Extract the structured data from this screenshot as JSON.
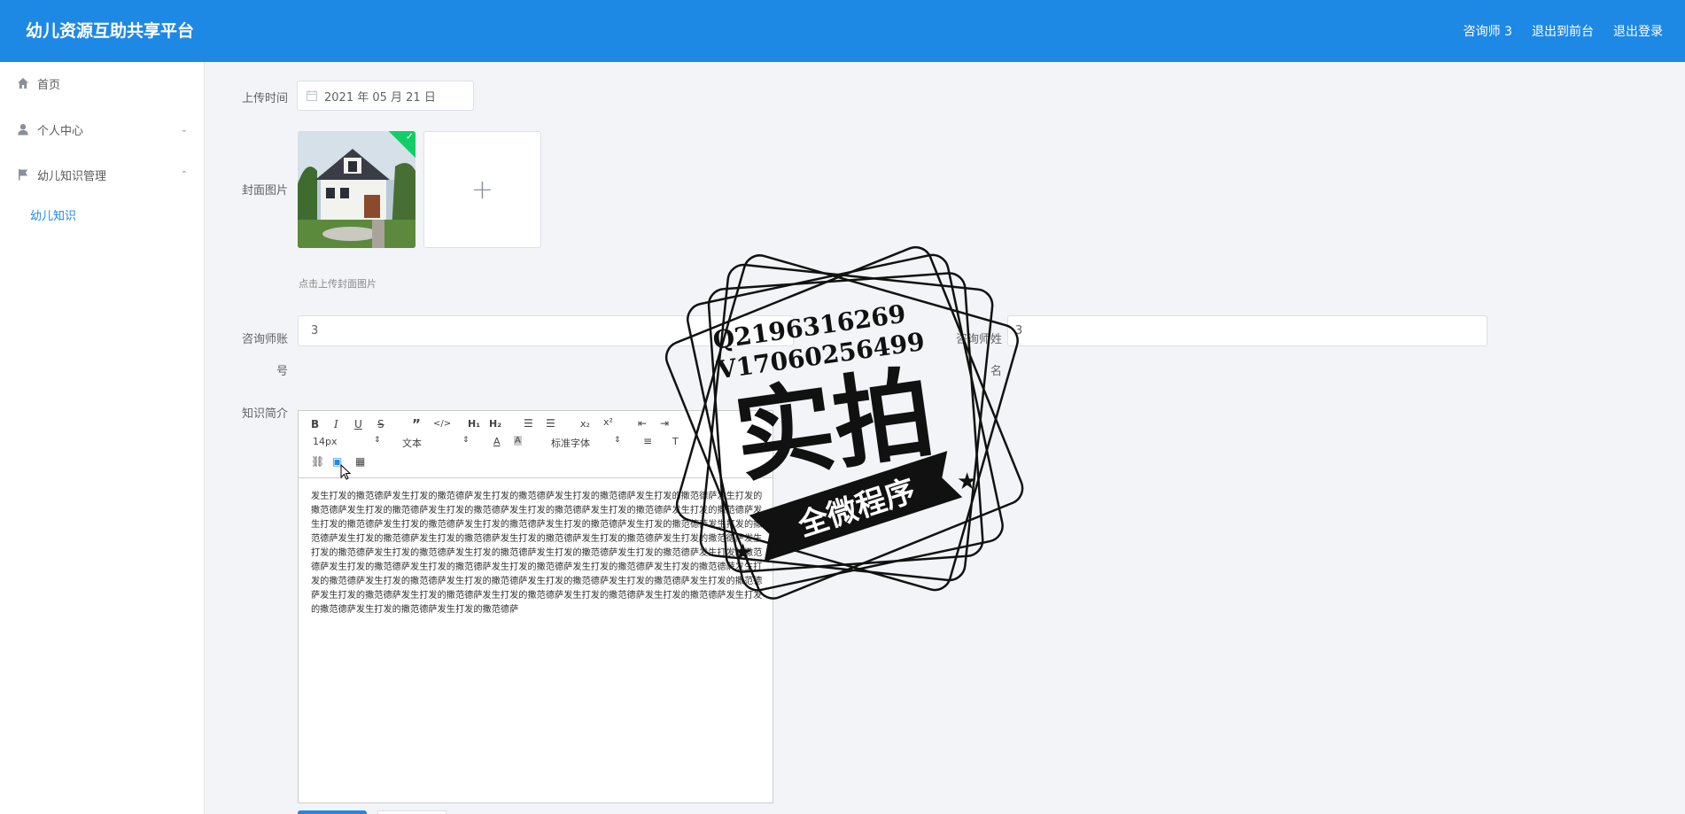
{
  "header": {
    "brand": "幼儿资源互助共享平台",
    "user": "咨询师 3",
    "back_front": "退出到前台",
    "logout": "退出登录",
    "color": "#1e88e5"
  },
  "sidebar": {
    "items": [
      {
        "label": "首页",
        "icon": "home-icon"
      },
      {
        "label": "个人中心",
        "icon": "user-icon",
        "chevron": "⌄"
      },
      {
        "label": "幼儿知识管理",
        "icon": "flag-icon",
        "chevron": "⌃"
      }
    ],
    "sub_item": "幼儿知识"
  },
  "form": {
    "upload_time_label": "上传时间",
    "upload_time_value": "2021 年 05 月 21 日",
    "cover_label": "封面图片",
    "upload_plus": "+",
    "upload_hint": "点击上传封面图片",
    "account_label_1": "咨询师账",
    "account_label_2": "号",
    "account_value": "3",
    "name_label_1": "咨询师姓",
    "name_label_2": "名",
    "name_value": "3",
    "intro_label": "知识简介"
  },
  "editor": {
    "font_size": "14px",
    "paragraph": "文本",
    "font_family": "标准字体",
    "content": "发生打发的撒范德萨发生打发的撒范德萨发生打发的撒范德萨发生打发的撒范德萨发生打发的撒范德萨发生打发的撒范德萨发生打发的撒范德萨发生打发的撒范德萨发生打发的撒范德萨发生打发的撒范德萨发生打发的撒范德萨发生打发的撒范德萨发生打发的撒范德萨发生打发的撒范德萨发生打发的撒范德萨发生打发的撒范德萨发生打发的撒范德萨发生打发的撒范德萨发生打发的撒范德萨发生打发的撒范德萨发生打发的撒范德萨发生打发的撒范德萨发生打发的撒范德萨发生打发的撒范德萨发生打发的撒范德萨发生打发的撒范德萨发生打发的撒范德萨发生打发的撒范德萨发生打发的撒范德萨发生打发的撒范德萨发生打发的撒范德萨发生打发的撒范德萨发生打发的撒范德萨发生打发的撒范德萨发生打发的撒范德萨发生打发的撒范德萨发生打发的撒范德萨发生打发的撒范德萨发生打发的撒范德萨发生打发的撒范德萨发生打发的撒范德萨发生打发的撒范德萨发生打发的撒范德萨发生打发的撒范德萨发生打发的撒范德萨发生打发的撒范德萨发生打发的撒范德萨"
  },
  "watermark": {
    "line1": "Q2196316269",
    "line2": "V17060256499",
    "big": "实拍",
    "ribbon": "全微程序"
  }
}
